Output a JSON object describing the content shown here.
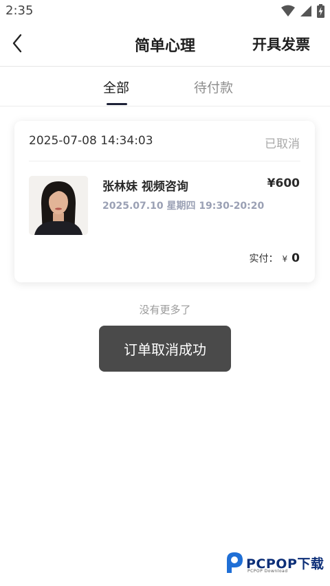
{
  "status_bar": {
    "time": "2:35",
    "icons": [
      "wifi-icon",
      "signal-icon",
      "battery-charging-icon"
    ]
  },
  "header": {
    "title": "简单心理",
    "action_label": "开具发票",
    "back_icon": "chevron-left-icon"
  },
  "tabs": [
    {
      "label": "全部",
      "active": true
    },
    {
      "label": "待付款",
      "active": false
    }
  ],
  "order": {
    "created_at": "2025-07-08 14:34:03",
    "status": "已取消",
    "service": "张林妹 视频咨询",
    "price": "¥600",
    "schedule": "2025.07.10 星期四 19:30-20:20",
    "paid_label": "实付：",
    "paid_currency": "¥",
    "paid_amount": "0"
  },
  "list_end_text": "没有更多了",
  "toast": "订单取消成功",
  "watermark": {
    "name": "PCPOP下载",
    "sub": "PCPOP Download"
  },
  "colors": {
    "accent": "#1c2036",
    "muted": "#9aa0b4",
    "toast_bg": "#4a4a4a"
  }
}
